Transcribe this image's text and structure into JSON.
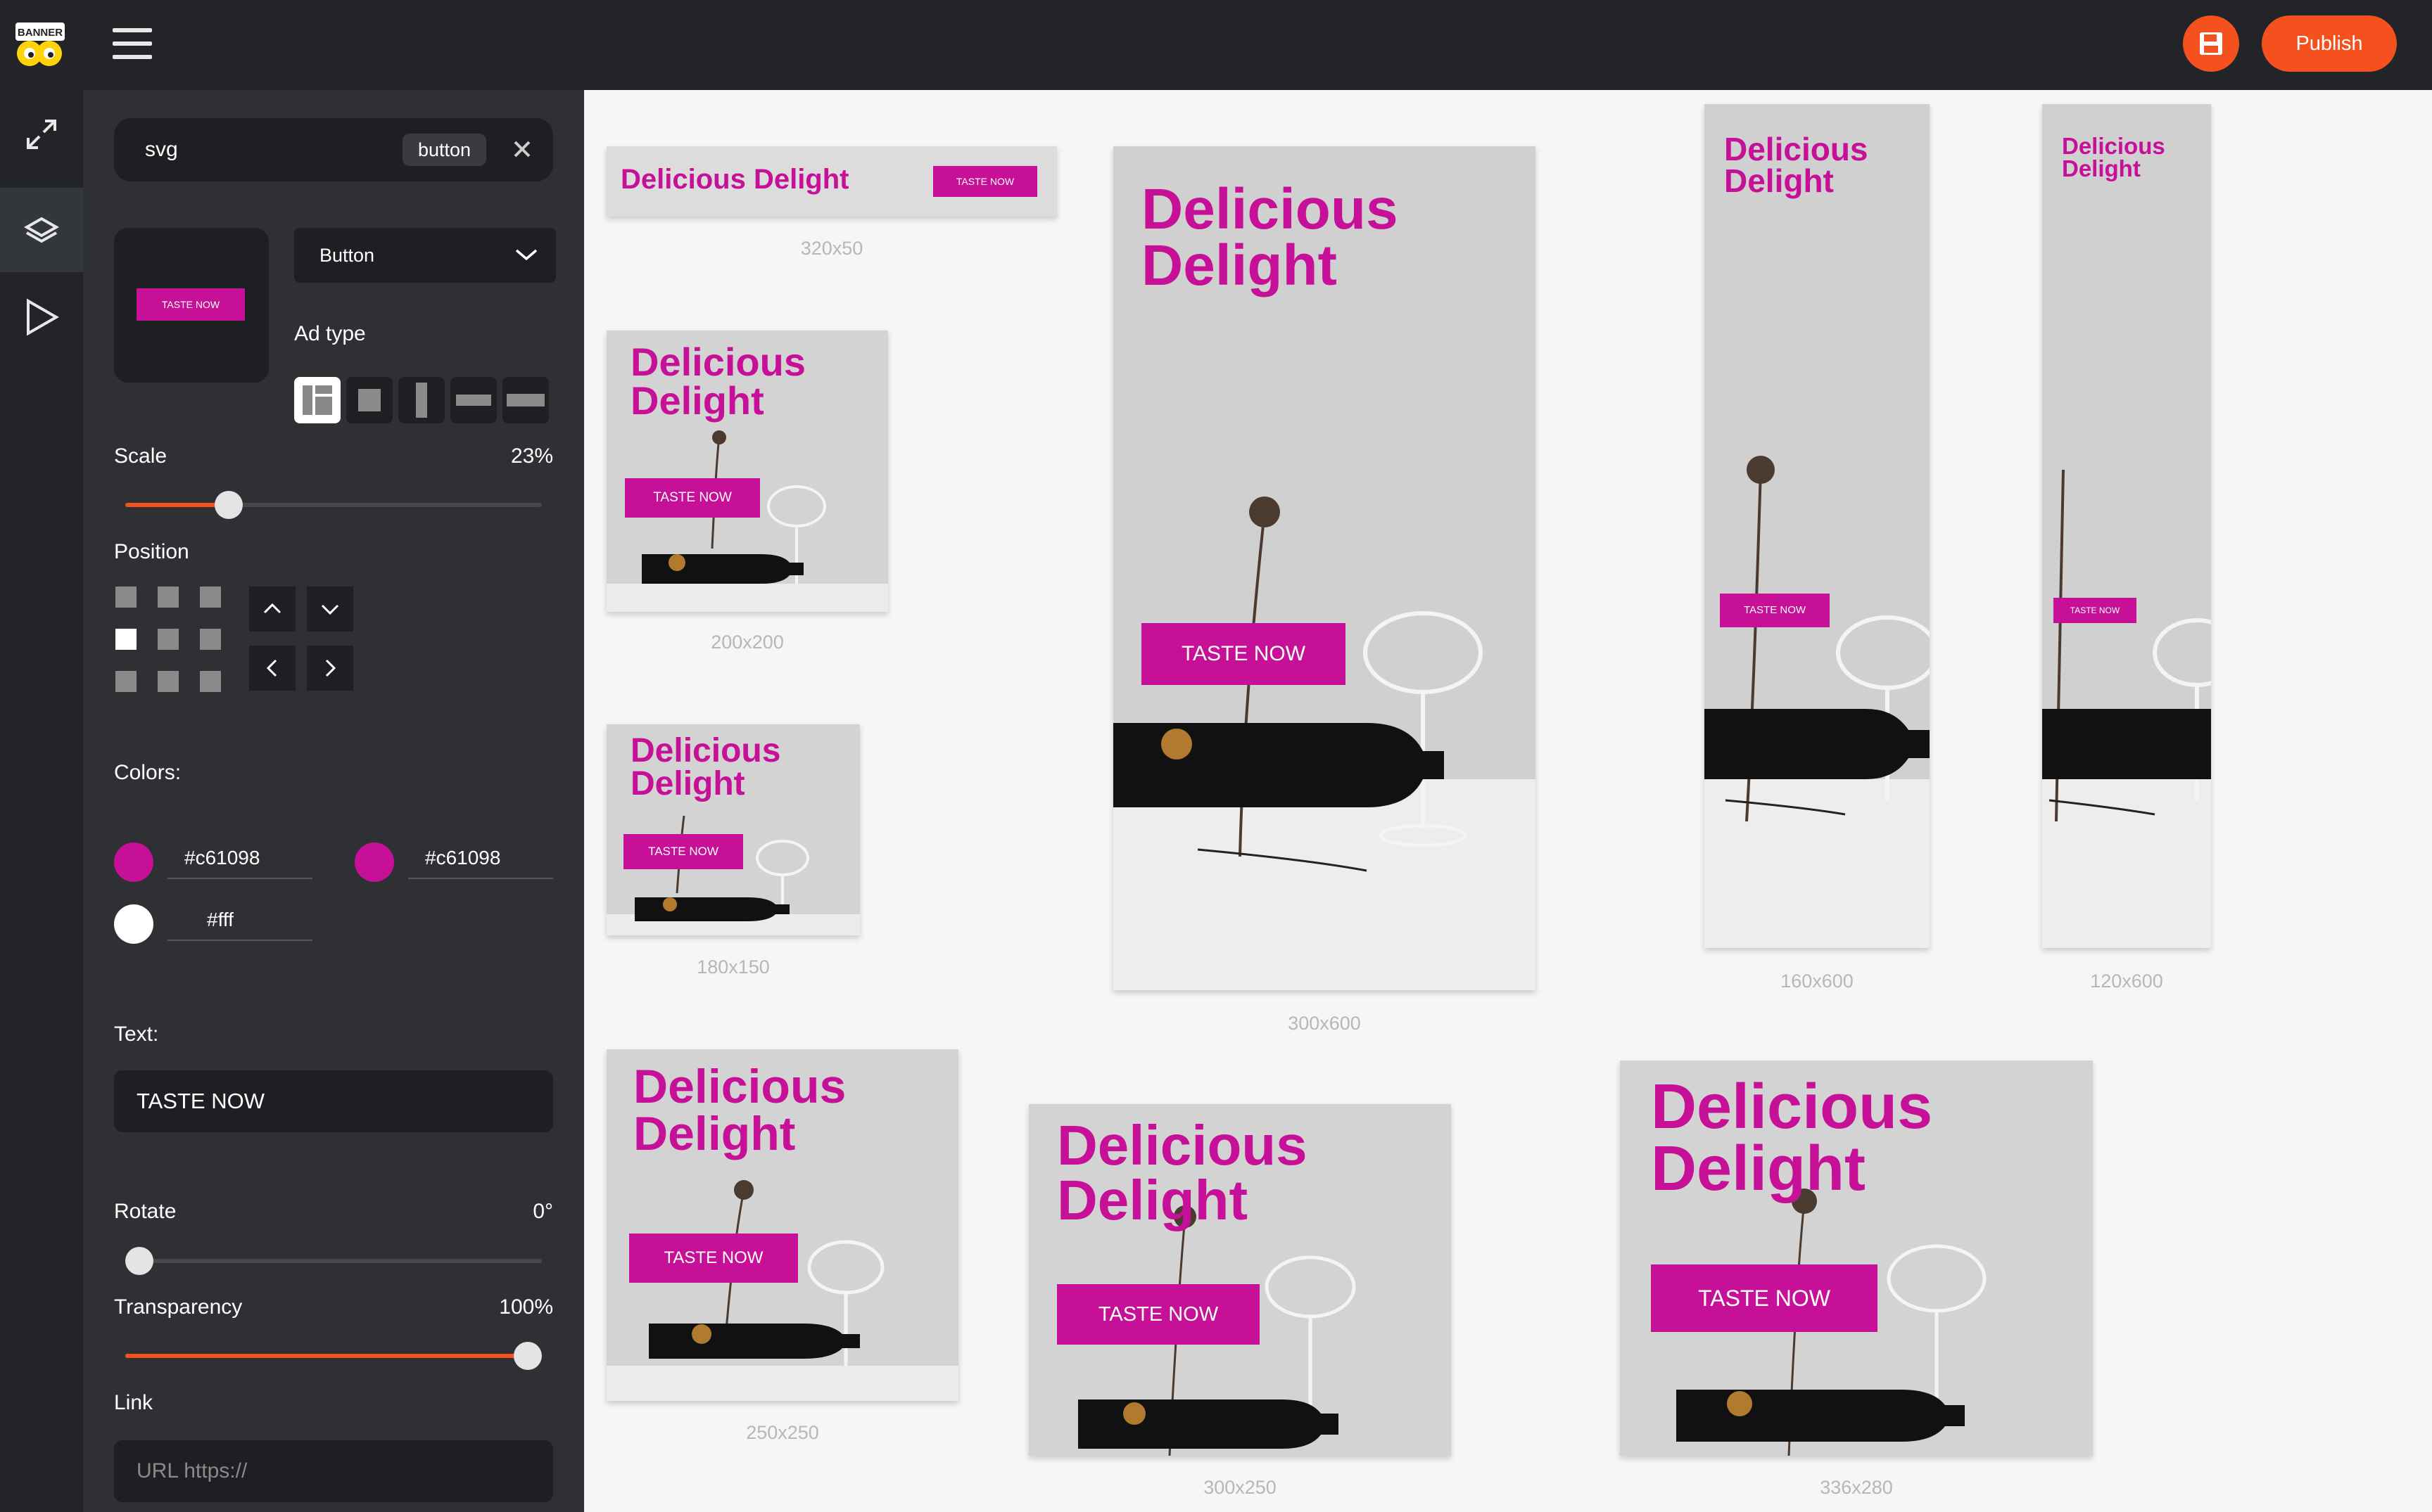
{
  "app": {
    "logo_text": "BANNER BOO",
    "publish_label": "Publish"
  },
  "panel": {
    "search_value": "svg",
    "chip_label": "button",
    "thumb_button_text": "TASTE NOW",
    "dropdown_value": "Button",
    "ad_type_label": "Ad type",
    "scale_label": "Scale",
    "scale_value": "23%",
    "scale_fraction": 0.23,
    "position_label": "Position",
    "colors_label": "Colors:",
    "colors": [
      {
        "swatch": "#c61098",
        "hex": "#c61098"
      },
      {
        "swatch": "#c61098",
        "hex": "#c61098"
      },
      {
        "swatch": "#ffffff",
        "hex": "#fff"
      }
    ],
    "text_label": "Text:",
    "text_value": "TASTE NOW",
    "rotate_label": "Rotate",
    "rotate_value": "0°",
    "rotate_fraction": 0,
    "transparency_label": "Transparency",
    "transparency_value": "100%",
    "transparency_fraction": 1.0,
    "link_label": "Link",
    "link_placeholder": "URL https://"
  },
  "banners": {
    "headline": "Delicious\nDelight",
    "cta": "TASTE NOW",
    "accent_color": "#c61098",
    "sizes": {
      "b320x50": "320x50",
      "b200x200": "200x200",
      "b180x150": "180x150",
      "b300x600": "300x600",
      "b160x600": "160x600",
      "b120x600": "120x600",
      "b250x250": "250x250",
      "b300x250": "300x250",
      "b336x280": "336x280"
    }
  },
  "icons": {
    "rail": [
      "expand-icon",
      "layers-icon",
      "play-icon"
    ],
    "toolbar": [
      "hamburger-icon",
      "save-icon"
    ]
  }
}
